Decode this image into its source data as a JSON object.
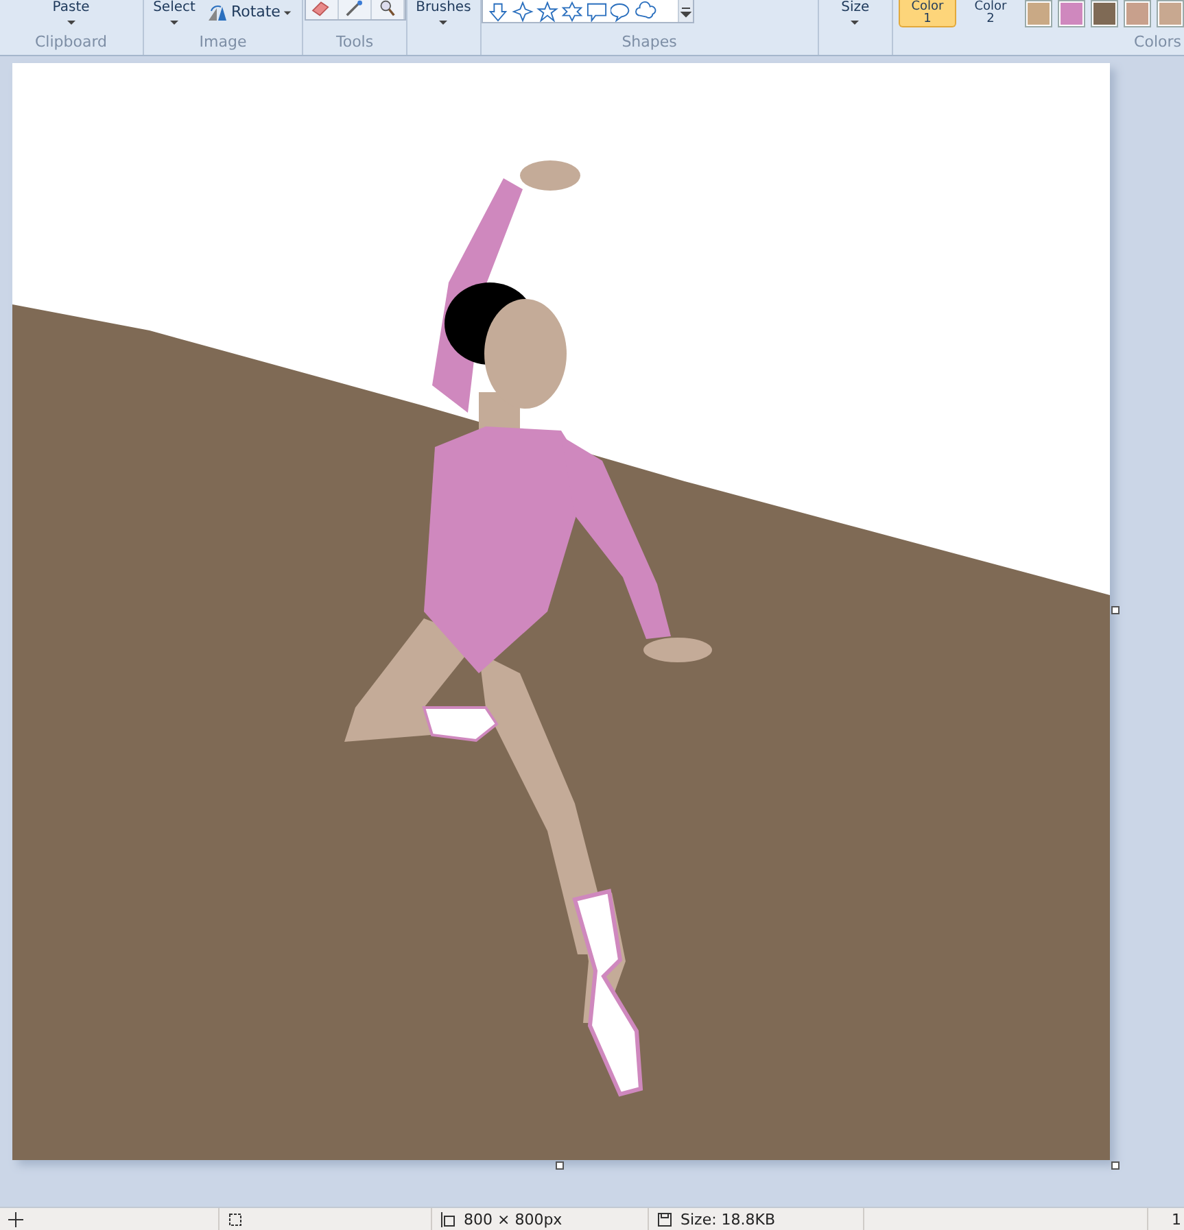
{
  "ribbon": {
    "groups": [
      {
        "label": "Clipboard",
        "kind": "dropdown",
        "tool": "Paste"
      },
      {
        "label": "Image",
        "kind": "image",
        "tool": "Select",
        "extra": "Rotate"
      },
      {
        "label": "Tools",
        "kind": "tools"
      },
      {
        "kind": "dropdown",
        "tool": "Brushes"
      },
      {
        "label": "Shapes",
        "kind": "shapes"
      },
      {
        "kind": "dropdown",
        "tool": "Size"
      },
      {
        "label": "Colors",
        "kind": "colors"
      }
    ],
    "color_buttons": [
      {
        "label": "Color",
        "number": "1",
        "selected": true
      },
      {
        "label": "Color",
        "number": "2",
        "selected": false
      }
    ],
    "swatches": [
      {
        "color": "#c9a985"
      },
      {
        "color": "#cf88be"
      },
      {
        "color": "#7f6a55"
      },
      {
        "color": "#c8a08c"
      },
      {
        "color": "#c8a890"
      }
    ]
  },
  "status_bar": {
    "dimensions": "800 × 800px",
    "size": "Size: 18.8KB",
    "zoom": "1"
  }
}
